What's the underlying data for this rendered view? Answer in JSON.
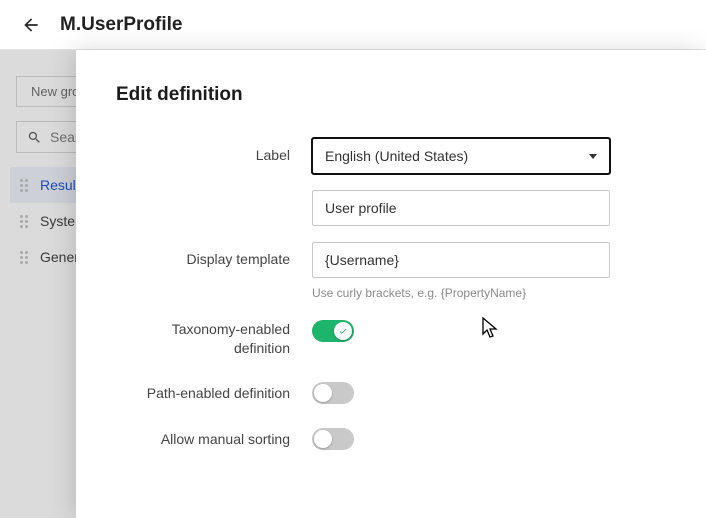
{
  "header": {
    "title": "M.UserProfile"
  },
  "sidebar": {
    "new_group_label": "New group",
    "search_placeholder": "Search",
    "items": [
      {
        "label": "Results"
      },
      {
        "label": "System"
      },
      {
        "label": "General"
      }
    ]
  },
  "modal": {
    "title": "Edit definition",
    "fields": {
      "label_label": "Label",
      "language_value": "English (United States)",
      "name_value": "User profile",
      "display_template_label": "Display template",
      "display_template_value": "{Username}",
      "display_template_hint": "Use curly brackets, e.g. {PropertyName}",
      "taxonomy_label": "Taxonomy-enabled definition",
      "taxonomy_on": true,
      "path_label": "Path-enabled definition",
      "path_on": false,
      "manual_sort_label": "Allow manual sorting",
      "manual_sort_on": false
    }
  }
}
